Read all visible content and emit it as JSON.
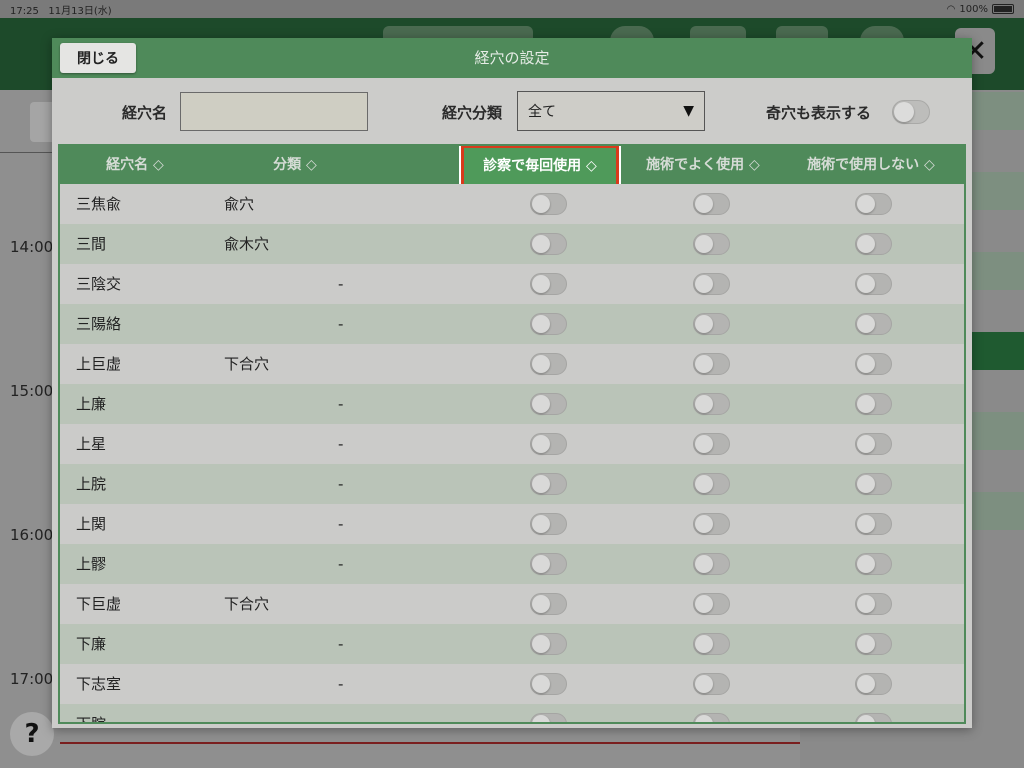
{
  "status_bar": {
    "time": "17:25",
    "date": "11月13日(水)",
    "battery": "100%"
  },
  "background": {
    "times": [
      "14:00",
      "15:00",
      "16:00",
      "17:00"
    ],
    "close_glyph": "✕",
    "help_glyph": "?"
  },
  "modal": {
    "title": "経穴の設定",
    "close_label": "閉じる",
    "filters": {
      "name_label": "経穴名",
      "name_value": "",
      "category_label": "経穴分類",
      "category_value": "全て",
      "category_arrow": "▼",
      "odd_points_label": "奇穴も表示する",
      "odd_points_on": false
    },
    "columns": [
      {
        "label": "経穴名 ◇"
      },
      {
        "label": "分類 ◇"
      },
      {
        "label": "診察で毎回使用 ◇"
      },
      {
        "label": "施術でよく使用 ◇"
      },
      {
        "label": "施術で使用しない ◇"
      }
    ],
    "rows": [
      {
        "name": "三焦兪",
        "category": "兪穴",
        "dash": ""
      },
      {
        "name": "三間",
        "category": "兪木穴",
        "dash": ""
      },
      {
        "name": "三陰交",
        "category": "",
        "dash": "-"
      },
      {
        "name": "三陽絡",
        "category": "",
        "dash": "-"
      },
      {
        "name": "上巨虚",
        "category": "下合穴",
        "dash": ""
      },
      {
        "name": "上廉",
        "category": "",
        "dash": "-"
      },
      {
        "name": "上星",
        "category": "",
        "dash": "-"
      },
      {
        "name": "上脘",
        "category": "",
        "dash": "-"
      },
      {
        "name": "上関",
        "category": "",
        "dash": "-"
      },
      {
        "name": "上髎",
        "category": "",
        "dash": "-"
      },
      {
        "name": "下巨虚",
        "category": "下合穴",
        "dash": ""
      },
      {
        "name": "下廉",
        "category": "",
        "dash": "-"
      },
      {
        "name": "下志室",
        "category": "",
        "dash": "-"
      },
      {
        "name": "下脘",
        "category": "",
        "dash": "-"
      }
    ]
  }
}
